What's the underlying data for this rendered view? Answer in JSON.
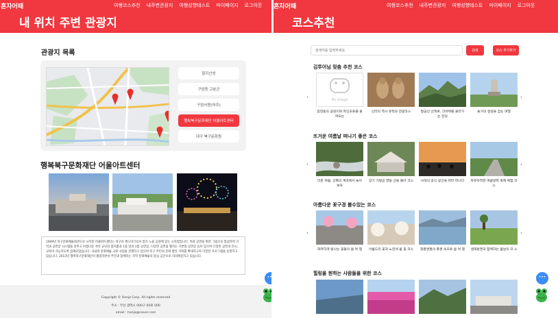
{
  "brand_color": "#f1373f",
  "left": {
    "logo": "혼자어때",
    "nav": [
      "여행코스추천",
      "내주변관광지",
      "여행성향테스트",
      "마이페이지",
      "로그아웃"
    ],
    "title": "내 위치 주변 관광지",
    "list_title": "관광지 목록",
    "places": [
      "함지산성",
      "구암동 고분군",
      "구암서원(마주)",
      "행복북구문화재단 어울아트센터",
      "대구 북구문화원"
    ],
    "selected_place_index": 3,
    "detail_title": "행복북구문화재단 어울아트센터",
    "description": "1999년 북구문화예술회관으로 시작한 어울아트센터는 북구의 랜드마크로서 함지 노을 공원에 있는 시작점입니다. 특화 공연을 위한 그림으로 통섭하여 기억과 공연장 시스템을 갖추고 아름다운 객석 규모의 함지홀과 1층 방과 2층 공연장, 다양한 공연을 펼치는 가변형 공연장 등이 있으며 다양한 공연과 전시, 교육이 가능하도록 설계되었습니다. 국내외 문화예술 교류 사업을 진행하고 있으며 북구 주민의 문화 향유 기회를 확대하고자 다양한 프로그램을 운영하고 있습니다. 2013년 행복북구문화재단이 출범하면서 주민과 함께하는 지역 문화예술의 중심 공간으로 자리매김하고 있습니다.",
    "footer": {
      "copyright": "Copyright © Honja Corp. All rights reserved",
      "address": "주소 : 부산 광역시 000구 00로 000",
      "email": "email : honja@naver.com"
    }
  },
  "right": {
    "logo": "혼자어때",
    "nav": [
      "여행코스추천",
      "내주변관광지",
      "여행성향테스트",
      "마이페이지",
      "로그아웃"
    ],
    "title": "코스추천",
    "search_placeholder": "검색어를 입력하세요.",
    "search_label": "검색",
    "add_course_label": "코스 추가하기",
    "noimage_label": "No image",
    "sections": [
      {
        "title": "김투어님 맞춤 추천 코스",
        "items": [
          "휴천동의 공원이와 파인오프를 올여오는",
          "신라의 역사 유적과 관광코스",
          "팔공산 산책로, 갓바위를 올라가 는 한길",
          "솔거의 정원을 걷는 여행"
        ]
      },
      {
        "title": "뜨거운 여름날 떠나기 좋은 코스",
        "items": [
          "더운 여름, 강폭의 계곡에서 놀아보자",
          "장기 가평군 영동 산을 돌아 코스",
          "사색의 휴식 공간을 따라 떠나다",
          "유유자적한 여름방학 축제 체험 코스"
        ]
      },
      {
        "title": "아름다운 꽃구경 볼수있는 코스",
        "items": [
          "화려하게 빛나는 꽃들의 봄 여 행",
          "아름드리 꽃과 노란색 봄 꽃 코스",
          "청풍명월의 풍경 속으로 봄 여 행",
          "생태환경과 함께하는 봄날의 코 스"
        ]
      },
      {
        "title": "힐링을 원하는 사람들을 위한 코스",
        "items": [
          "",
          "",
          "",
          ""
        ]
      }
    ]
  }
}
